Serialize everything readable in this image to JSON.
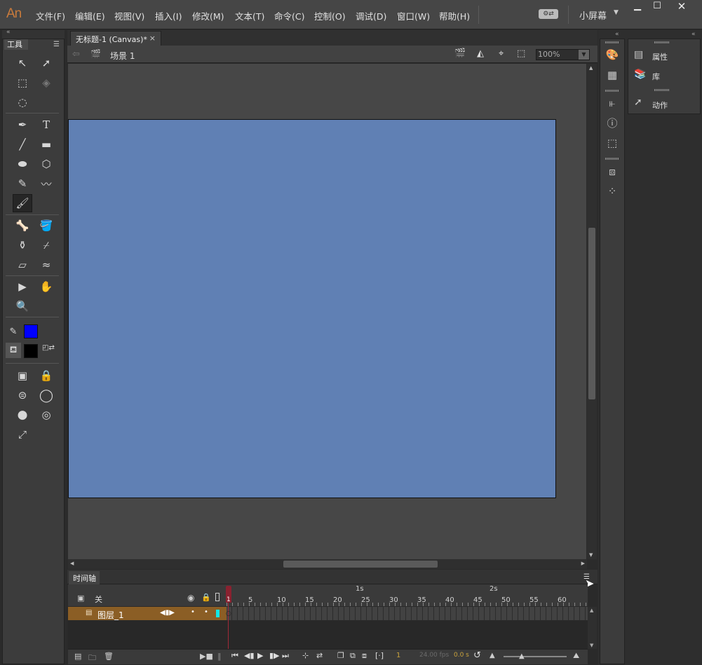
{
  "app": {
    "logo": "An"
  },
  "menu": {
    "items": [
      "文件(F)",
      "编辑(E)",
      "视图(V)",
      "插入(I)",
      "修改(M)",
      "文本(T)",
      "命令(C)",
      "控制(O)",
      "调试(D)",
      "窗口(W)",
      "帮助(H)"
    ]
  },
  "workspace": {
    "label": "小屏幕"
  },
  "tools": {
    "tab_label": "工具",
    "stroke_color": "#0000ff",
    "fill_color": "#000000"
  },
  "document": {
    "tab_label": "无标题-1 (Canvas)*",
    "close": "×",
    "scene": "场景 1",
    "zoom": "100%",
    "stage_color": "#6080b4"
  },
  "timeline": {
    "tab_label": "时间轴",
    "layer_column_label": "关",
    "layer_name": "图层_1",
    "ruler_seconds": [
      "1s",
      "2s"
    ],
    "ruler_frames": [
      "1",
      "5",
      "10",
      "15",
      "20",
      "25",
      "30",
      "35",
      "40",
      "45",
      "50",
      "55",
      "60"
    ],
    "current_frame": "1",
    "fps": "24.00 fps",
    "time": "0.0 s"
  },
  "panels": {
    "properties": "属性",
    "library": "库",
    "actions": "动作"
  }
}
